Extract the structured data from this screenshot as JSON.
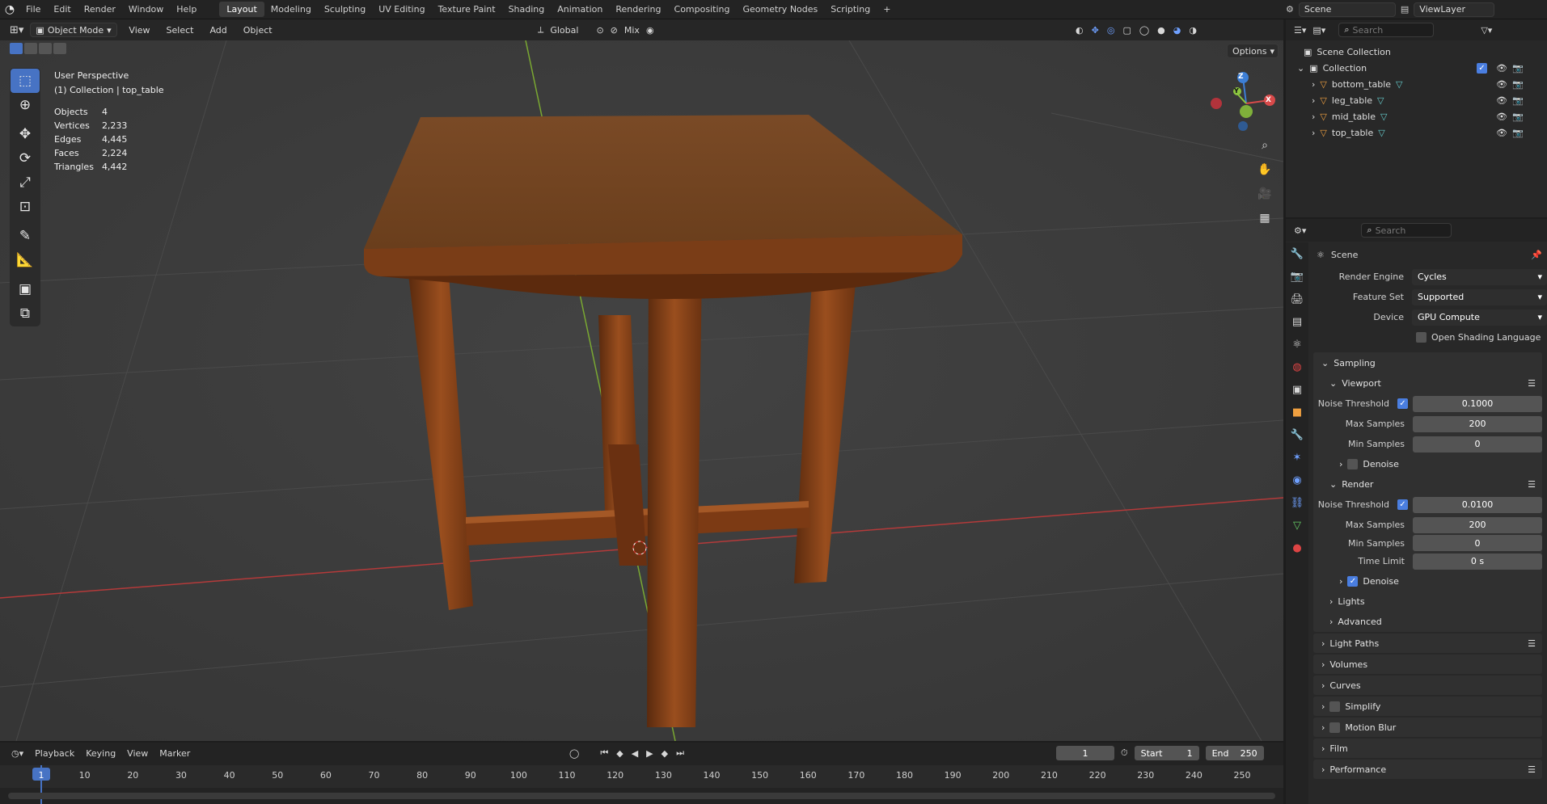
{
  "topbar": {
    "menu": [
      "File",
      "Edit",
      "Render",
      "Window",
      "Help"
    ],
    "workspaces": [
      "Layout",
      "Modeling",
      "Sculpting",
      "UV Editing",
      "Texture Paint",
      "Shading",
      "Animation",
      "Rendering",
      "Compositing",
      "Geometry Nodes",
      "Scripting"
    ],
    "active_workspace": "Layout",
    "add_tab": "+",
    "scene": "Scene",
    "view_layer": "ViewLayer"
  },
  "viewport_header": {
    "mode": "Object Mode",
    "menus": [
      "View",
      "Select",
      "Add",
      "Object"
    ],
    "orientation": "Global",
    "snap_mode": "Mix",
    "options": "Options"
  },
  "overlay": {
    "perspective": "User Perspective",
    "collection": "(1) Collection | top_table",
    "stats": [
      {
        "label": "Objects",
        "value": "4"
      },
      {
        "label": "Vertices",
        "value": "2,233"
      },
      {
        "label": "Edges",
        "value": "4,445"
      },
      {
        "label": "Faces",
        "value": "2,224"
      },
      {
        "label": "Triangles",
        "value": "4,442"
      }
    ],
    "gizmo_axes": {
      "z": "Z",
      "y": "Y",
      "x": "X"
    }
  },
  "outliner": {
    "search_placeholder": "Search",
    "scene_collection": "Scene Collection",
    "collection": "Collection",
    "objects": [
      "bottom_table",
      "leg_table",
      "mid_table",
      "top_table"
    ]
  },
  "properties": {
    "search_placeholder": "Search",
    "context": "Scene",
    "render_engine": {
      "label": "Render Engine",
      "value": "Cycles"
    },
    "feature_set": {
      "label": "Feature Set",
      "value": "Supported"
    },
    "device": {
      "label": "Device",
      "value": "GPU Compute"
    },
    "osl": "Open Shading Language",
    "sampling": "Sampling",
    "viewport": {
      "title": "Viewport",
      "noise_threshold": {
        "label": "Noise Threshold",
        "value": "0.1000"
      },
      "max_samples": {
        "label": "Max Samples",
        "value": "200"
      },
      "min_samples": {
        "label": "Min Samples",
        "value": "0"
      },
      "denoise": "Denoise"
    },
    "render": {
      "title": "Render",
      "noise_threshold": {
        "label": "Noise Threshold",
        "value": "0.0100"
      },
      "max_samples": {
        "label": "Max Samples",
        "value": "200"
      },
      "min_samples": {
        "label": "Min Samples",
        "value": "0"
      },
      "time_limit": {
        "label": "Time Limit",
        "value": "0 s"
      },
      "denoise": "Denoise"
    },
    "lights": "Lights",
    "advanced": "Advanced",
    "panels": [
      "Light Paths",
      "Volumes",
      "Curves",
      "Simplify",
      "Motion Blur",
      "Film",
      "Performance"
    ]
  },
  "timeline": {
    "menus": [
      "Playback",
      "Keying",
      "View",
      "Marker"
    ],
    "current_frame": "1",
    "start_label": "Start",
    "start": "1",
    "end_label": "End",
    "end": "250",
    "ticks": [
      "1",
      "10",
      "20",
      "30",
      "40",
      "50",
      "60",
      "70",
      "80",
      "90",
      "100",
      "110",
      "120",
      "130",
      "140",
      "150",
      "160",
      "170",
      "180",
      "190",
      "200",
      "210",
      "220",
      "230",
      "240",
      "250"
    ]
  },
  "colors": {
    "accent": "#4773c4",
    "x_axis": "#d84a4a",
    "y_axis": "#8cc63f",
    "z_axis": "#3d7fd6",
    "wood": "#8a4a1f"
  }
}
